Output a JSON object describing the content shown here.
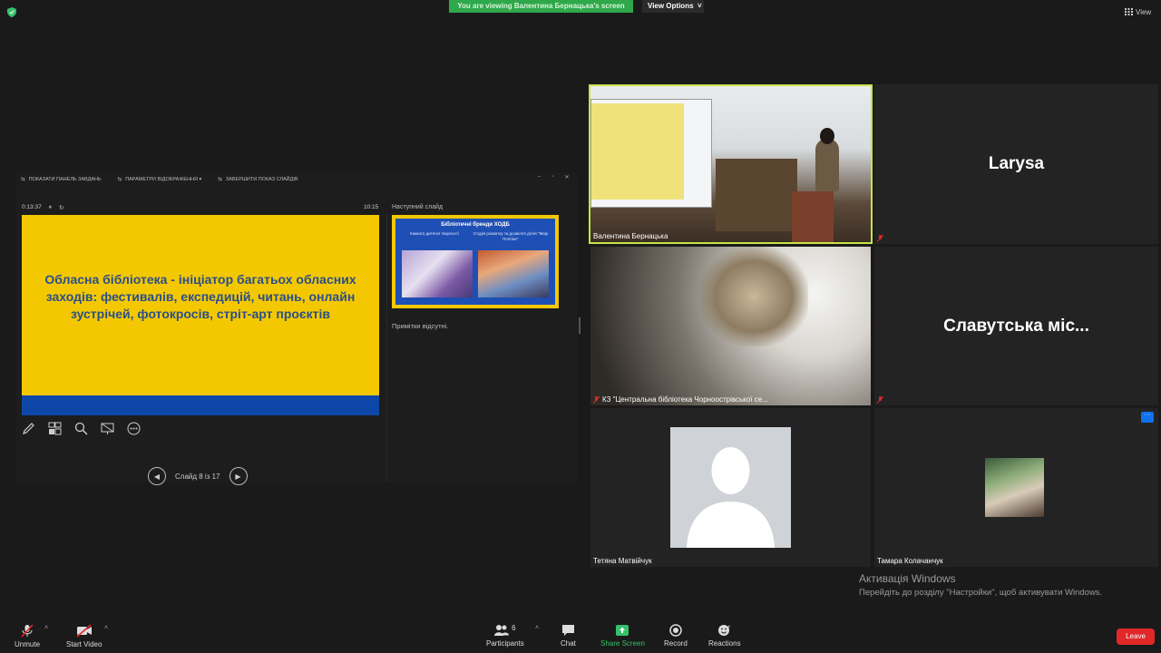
{
  "top_bar": {
    "viewing_banner": "You are viewing Валентина Бернацька's screen",
    "view_options": "View Options",
    "view": "View"
  },
  "presenter_view": {
    "toolbar": {
      "show_taskbar": "ПОКАЗАТИ ПАНЕЛЬ ЗАВДАНЬ",
      "display_settings": "ПАРАМЕТРИ ВІДОБРАЖЕННЯ ▾",
      "end_slideshow": "ЗАВЕРШИТИ ПОКАЗ СЛАЙДІВ"
    },
    "elapsed_time": "0:13:37",
    "clock": "10:15",
    "current_slide_text": "Обласна бібліотека - ініціатор багатьох обласних заходів: фестивалів, експедицій, читань, онлайн зустрічей, фотокросів, стріт-арт проєктів",
    "next_slide_label": "Наступний слайд",
    "next_slide": {
      "title": "Бібліотечні бренди ХОДБ",
      "left_caption": "Кімната дитячої творчості",
      "right_caption": "Студія розвитку та дозвілля дітей \"Мері Поппінс\""
    },
    "notes": "Примітки відсутні.",
    "slide_counter": "Слайд 8 із 17"
  },
  "participants_grid": [
    {
      "name": "Валентина Бернацька",
      "muted": false,
      "active_speaker": true,
      "video": "classroom"
    },
    {
      "name": "Larysa",
      "muted": true,
      "video": "none"
    },
    {
      "name": "КЗ \"Центральна бібліотека Чорноострівської се...",
      "muted": true,
      "video": "webcam"
    },
    {
      "name": "Славутська міс...",
      "muted": true,
      "video": "none"
    },
    {
      "name": "Тетяна Матвійчук",
      "muted": false,
      "video": "avatar-placeholder"
    },
    {
      "name": "Тамара Колачанчук",
      "muted": false,
      "video": "thumbnail"
    }
  ],
  "windows_activation": {
    "title": "Активація Windows",
    "subtitle": "Перейдіть до розділу \"Настройки\", щоб активувати Windows."
  },
  "controls": {
    "unmute": "Unmute",
    "start_video": "Start Video",
    "participants": "Participants",
    "participants_count": "6",
    "chat": "Chat",
    "share_screen": "Share Screen",
    "record": "Record",
    "reactions": "Reactions",
    "leave": "Leave"
  },
  "colors": {
    "active_speaker_border": "#c8e24a",
    "share_green": "#35c26b",
    "leave_red": "#e02828",
    "slide_yellow": "#f4c800",
    "slide_blue": "#0e47a8"
  }
}
